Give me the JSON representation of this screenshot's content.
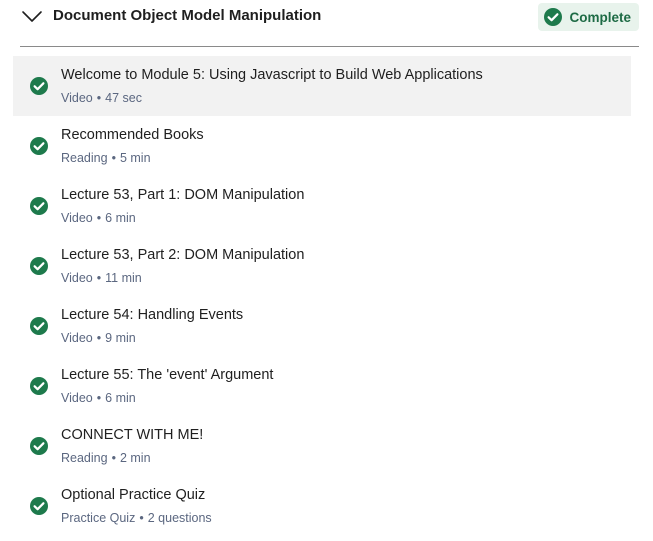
{
  "module": {
    "title": "Document Object Model Manipulation",
    "status_label": "Complete",
    "toggle_icon": "chevron-down-icon",
    "status_icon": "check-circle-icon"
  },
  "colors": {
    "accent_green": "#1e7a4c",
    "badge_background": "#e8f3ec",
    "badge_text": "#1e6b45",
    "active_row_background": "#f2f2f2",
    "meta_text": "#5b6780"
  },
  "items": [
    {
      "title": "Welcome to Module 5: Using Javascript to Build Web Applications",
      "type": "Video",
      "duration": "47 sec",
      "active": true
    },
    {
      "title": "Recommended Books",
      "type": "Reading",
      "duration": "5 min",
      "active": false
    },
    {
      "title": "Lecture 53, Part 1: DOM Manipulation",
      "type": "Video",
      "duration": "6 min",
      "active": false
    },
    {
      "title": "Lecture 53, Part 2: DOM Manipulation",
      "type": "Video",
      "duration": "11 min",
      "active": false
    },
    {
      "title": "Lecture 54: Handling Events",
      "type": "Video",
      "duration": "9 min",
      "active": false
    },
    {
      "title": "Lecture 55: The 'event' Argument",
      "type": "Video",
      "duration": "6 min",
      "active": false
    },
    {
      "title": "CONNECT WITH ME!",
      "type": "Reading",
      "duration": "2 min",
      "active": false
    },
    {
      "title": "Optional Practice Quiz",
      "type": "Practice Quiz",
      "duration": "2 questions",
      "active": false
    }
  ]
}
